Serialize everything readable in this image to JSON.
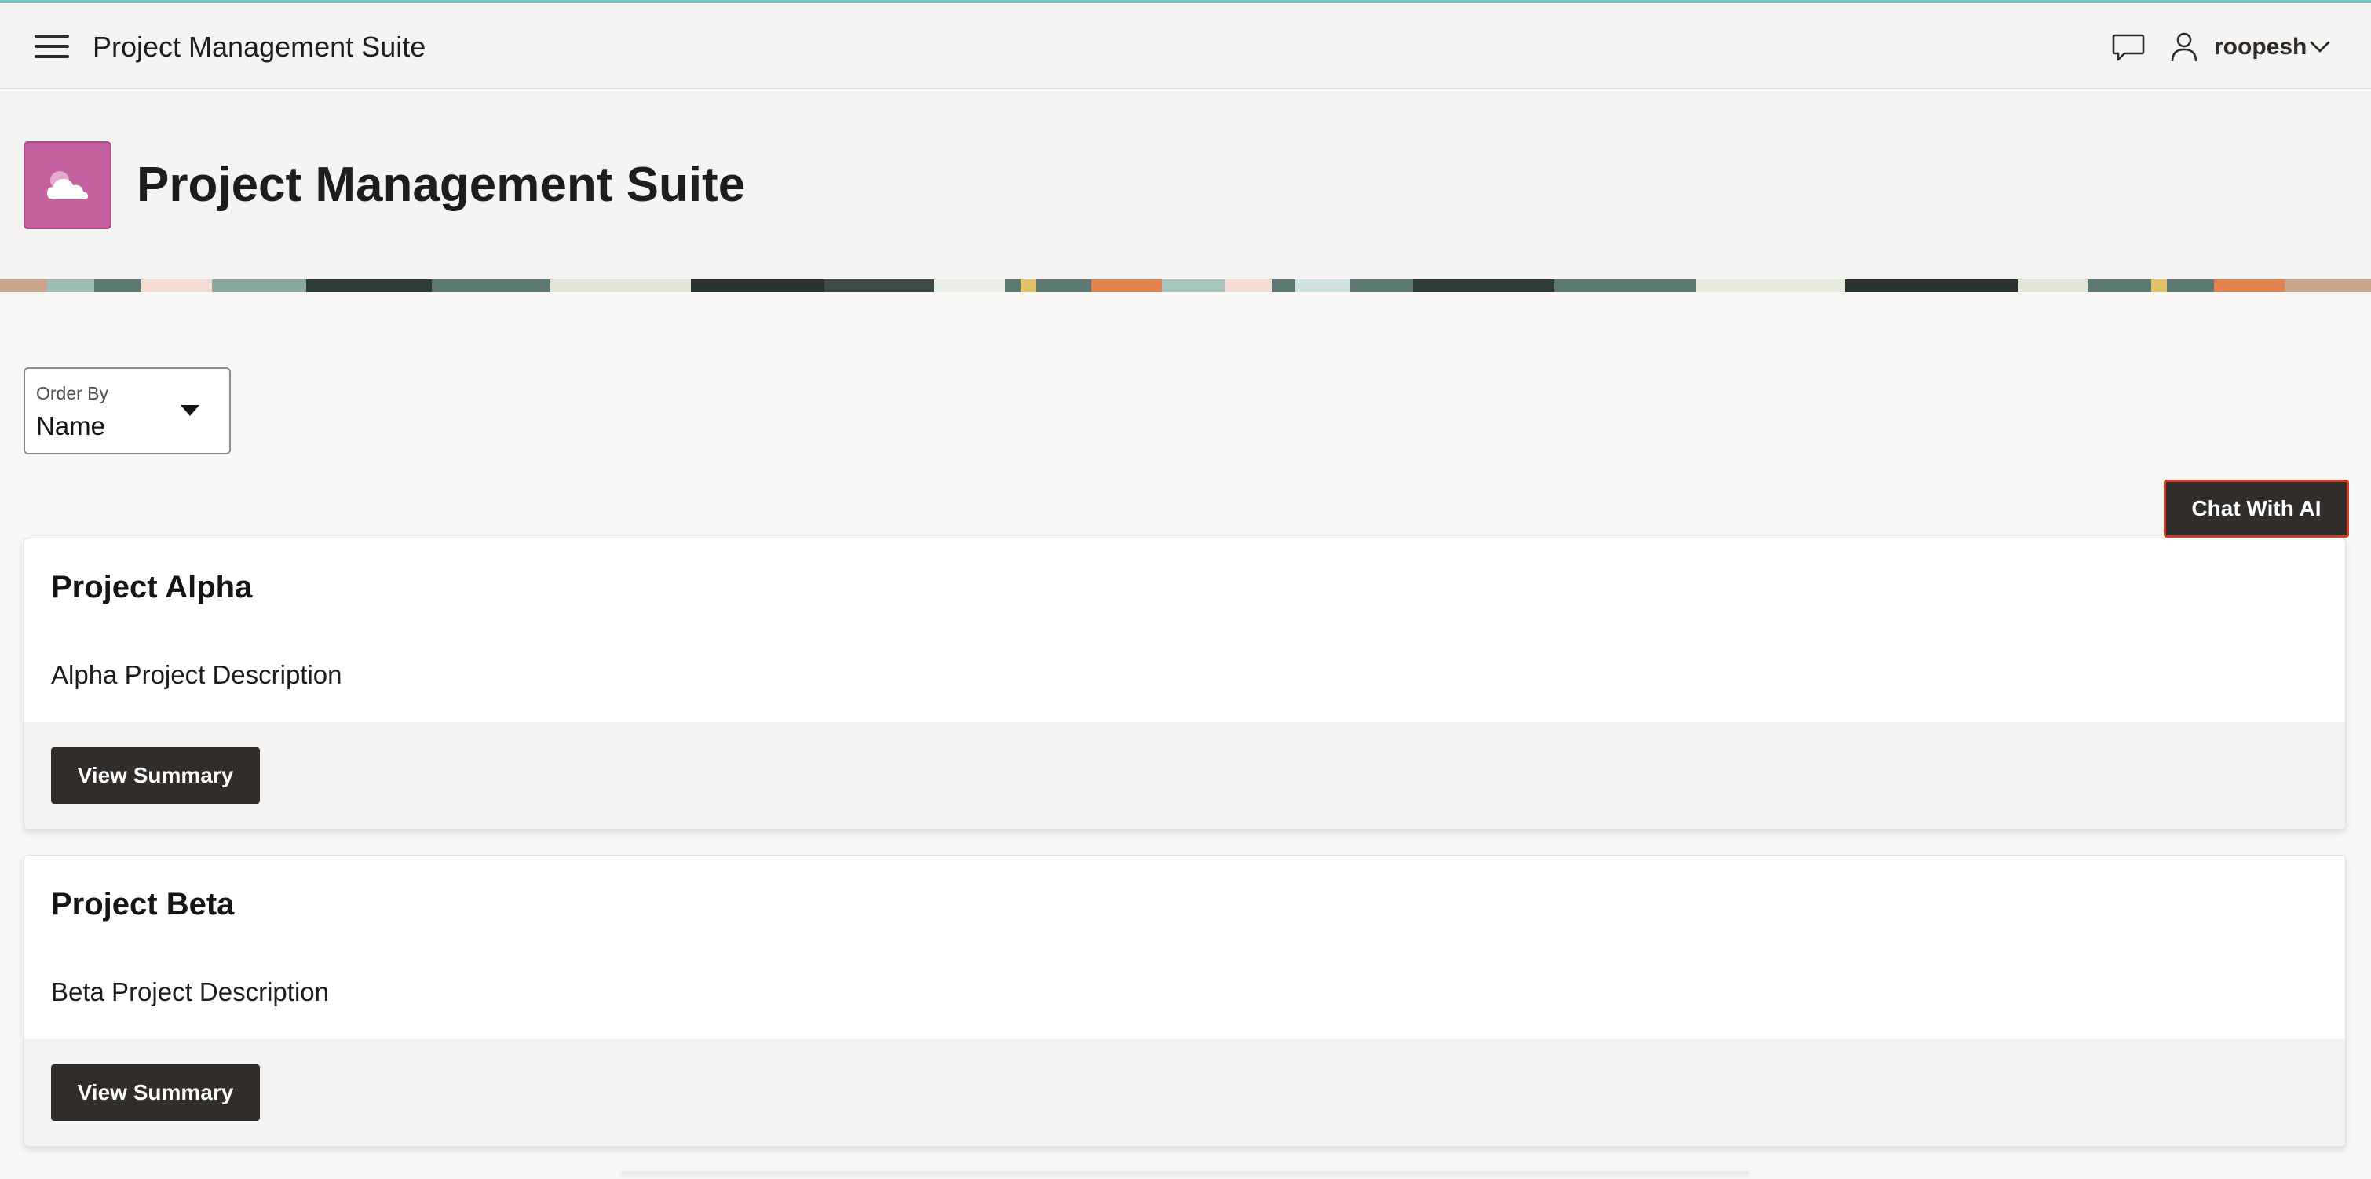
{
  "header": {
    "app_title": "Project Management Suite",
    "user_name": "roopesh",
    "icons": [
      "hamburger-menu-icon",
      "chat-bubble-icon",
      "user-icon",
      "chevron-down-icon"
    ]
  },
  "hero": {
    "title": "Project Management Suite",
    "icon": "cloud-icon",
    "icon_color": "#c4619f"
  },
  "filters": {
    "order_by_label": "Order By",
    "order_by_value": "Name"
  },
  "actions": {
    "chat_button": "Chat With AI"
  },
  "projects": [
    {
      "title": "Project Alpha",
      "description": "Alpha Project Description",
      "button": "View Summary"
    },
    {
      "title": "Project Beta",
      "description": "Beta Project Description",
      "button": "View Summary"
    }
  ],
  "colors": {
    "button_dark": "#312d2a",
    "accent_border": "#d23c22",
    "top_line": "#7fbfc1"
  }
}
